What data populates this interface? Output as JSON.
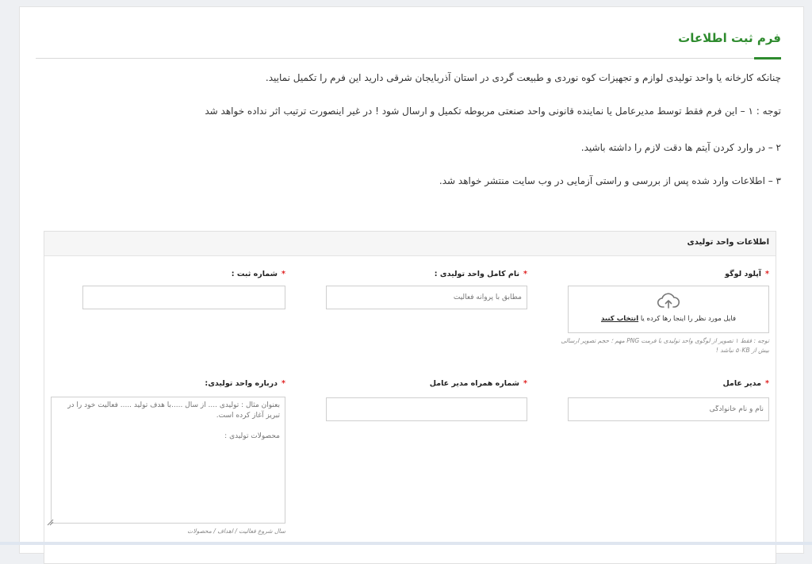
{
  "page": {
    "title": "فرم ثبت اطلاعات",
    "intro": "چنانکه کارخانه یا واحد تولیدی لوازم و تجهیزات کوه نوردی و طبیعت گردی در استان آذربایجان شرقی دارید این فرم را تکمیل نمایید.",
    "notes": [
      "توجه : ۱ – این فرم فقط توسط مدیرعامل یا نماینده قانونی واحد صنعتی مربوطه تکمیل و ارسال شود ! در غیر اینصورت ترتیب اثر نداده خواهد شد",
      "۲ – در وارد کردن آیتم ها دقت لازم را داشته باشید.",
      "۳ – اطلاعات وارد شده پس از بررسی و راستی آزمایی در وب سایت منتشر خواهد شد."
    ]
  },
  "form": {
    "section_title": "اطلاعات واحد تولیدی",
    "required_mark": "*",
    "logo": {
      "label": "آپلود لوگو",
      "upload_text": "فایل مورد نظر را اینجا رها کرده یا",
      "upload_link": "انتخاب کنید",
      "note_line1": "توجه : فقط ۱ تصویر از لوگوی واحد تولیدی با فرمت PNG مهم ؛ حجم تصویر ارسالی",
      "note_line2": "بیش از ۵۰KB نباشد !"
    },
    "unit_name": {
      "label": "نام کامل واحد تولیدی :",
      "placeholder": "مطابق با پروانه فعالیت"
    },
    "reg_number": {
      "label": "شماره ثبت :",
      "placeholder": ""
    },
    "ceo": {
      "label": "مدیر عامل",
      "placeholder": "نام و نام خانوادگی"
    },
    "ceo_phone": {
      "label": "شماره همراه مدیر عامل",
      "placeholder": ""
    },
    "about": {
      "label": "درباره واحد تولیدی:",
      "placeholder": "بعنوان مثال : تولیدی .... از سال .....با هدف تولید ..... فعالیت خود را در تبریز آغاز کرده است.\n\nمحصولات تولیدی :",
      "note": "سال شروع فعالیت / اهداف / محصولات"
    }
  },
  "colors": {
    "accent": "#2e8b2e",
    "required": "#e02424"
  },
  "icons": {
    "upload": "cloud-upload-icon",
    "resize": "resize-handle-icon"
  }
}
